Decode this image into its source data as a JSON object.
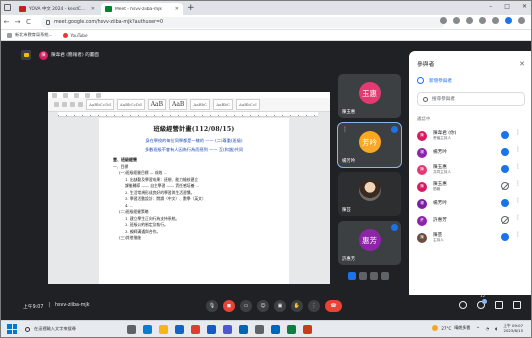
{
  "browser": {
    "tabs": [
      {
        "title": "YOVA 中文 2024 - kesdChinapu",
        "active": false
      },
      {
        "title": "Meet - hsvv-ziiba-mjk",
        "active": true
      }
    ],
    "new_tab": "+",
    "window_controls": {
      "minimize": "–",
      "maximize": "□",
      "close": "✕"
    },
    "nav": {
      "back": "←",
      "forward": "→",
      "reload": "C",
      "home": "⌂"
    },
    "url": "meet.google.com/hsvv-ziiba-mjk?authuser=0",
    "bookmarks": [
      {
        "label": "新北市教育局系統...",
        "icon": "folder-icon"
      },
      {
        "label": "YouTube",
        "icon": "youtube-icon"
      }
    ]
  },
  "meet": {
    "presenter_chip": "陳韋君 (簡報者) 的畫面",
    "presenter_initial": "陳",
    "document": {
      "style_previews": [
        "AaBbCcDd",
        "AaBbCcDd",
        "AaB",
        "AaB",
        "AaBbC",
        "AaBbC",
        "AaBbCcI"
      ],
      "title": "班級經營計畫(112/08/15)",
      "blue_lines": [
        "身在學校的每位同學都是一樣的 —— (二)尊重(班級)",
        "多數班級不會有人因為行為而感到 —— 互(和諧)共同"
      ],
      "lines": [
        {
          "text": "壹、班級經營",
          "level": "sec"
        },
        {
          "text": "一、目標",
          "level": "0"
        },
        {
          "text": "(一)班級經營目標 — 成效 ...",
          "level": "1"
        },
        {
          "text": "1. 出缺勤及學習成果：班規、能力檢核建立",
          "level": "2"
        },
        {
          "text": "   課後輔導 —— 自主學習 —— 責任感培養 ...",
          "level": "2"
        },
        {
          "text": "2. 生活常規形成良好的學習與生活習慣。",
          "level": "2"
        },
        {
          "text": "3. 學習活動設計：閱讀（中文）、數學（英文）",
          "level": "2"
        },
        {
          "text": "4. ...",
          "level": "2"
        },
        {
          "text": "(二)班級經營策略",
          "level": "1"
        },
        {
          "text": "1. 建立學生正向行為支持系統。",
          "level": "2"
        },
        {
          "text": "2. 班級公約制定及執行。",
          "level": "2"
        },
        {
          "text": "3. 親師溝通與合作。",
          "level": "2"
        },
        {
          "text": "(三)其他措施",
          "level": "1"
        }
      ]
    },
    "tiles": [
      {
        "initial": "玉惠",
        "name": "陳玉惠",
        "color": "#e53972"
      },
      {
        "initial": "芳吟",
        "name": "楊芳吟",
        "color": "#f9a825"
      },
      {
        "initial": "",
        "name": "陳芸",
        "color": "#6d4c41"
      },
      {
        "initial": "惠芳",
        "name": "許惠芳",
        "color": "#8e24aa"
      }
    ],
    "time": "上午9:07",
    "separator": "|",
    "meeting_code": "hsvv-ziiba-mjk",
    "controls": [
      "mic-icon",
      "camera-icon",
      "captions-icon",
      "emoji-icon",
      "present-icon",
      "raise-hand-icon",
      "more-icon",
      "hangup-icon"
    ],
    "participant_count": "12"
  },
  "people_panel": {
    "title": "參與者",
    "close": "✕",
    "add_people": "新增參與者",
    "search_placeholder": "搜尋參與者",
    "section_title": "通話中",
    "participants": [
      {
        "name": "陳韋君 (你)",
        "role": "會議主持人",
        "initial": "陳",
        "color": "#d81b60",
        "mic": "on"
      },
      {
        "name": "楊芳吟",
        "role": "",
        "initial": "楊",
        "color": "#8e24aa",
        "mic": "on"
      },
      {
        "name": "陳玉惠",
        "role": "共同主持人",
        "initial": "陳",
        "color": "#e53972",
        "mic": "on"
      },
      {
        "name": "陳玉惠",
        "role": "簡報",
        "initial": "陳",
        "color": "#d81b60",
        "mic": "off"
      },
      {
        "name": "楊芳吟",
        "role": "",
        "initial": "楊",
        "color": "#7b1fa2",
        "mic": "on"
      },
      {
        "name": "許惠芳",
        "role": "",
        "initial": "許",
        "color": "#8e24aa",
        "mic": "off"
      },
      {
        "name": "陳芸",
        "role": "主持人",
        "initial": "陳",
        "color": "#6d4c41",
        "mic": "on"
      }
    ]
  },
  "taskbar": {
    "search_placeholder": "在這裡輸入文字來搜尋",
    "apps": [
      "task-view-icon",
      "edge-icon",
      "explorer-icon",
      "store-icon",
      "chrome-icon",
      "word-icon",
      "teams-icon",
      "outlook-icon",
      "settings-icon",
      "photos-icon",
      "excel-icon",
      "powerpoint-icon"
    ],
    "weather_temp": "27°C",
    "weather_text": "晴朗多雲",
    "clock_time": "上午 09:07",
    "clock_date": "2023/8/15",
    "app_colors": [
      "#5f6368",
      "#0f7cc9",
      "#f2b90f",
      "#1565c0",
      "#e53935",
      "#185abd",
      "#5059c9",
      "#0a64ad",
      "#5f6368",
      "#0067b8",
      "#107c41",
      "#c43e1c"
    ]
  }
}
